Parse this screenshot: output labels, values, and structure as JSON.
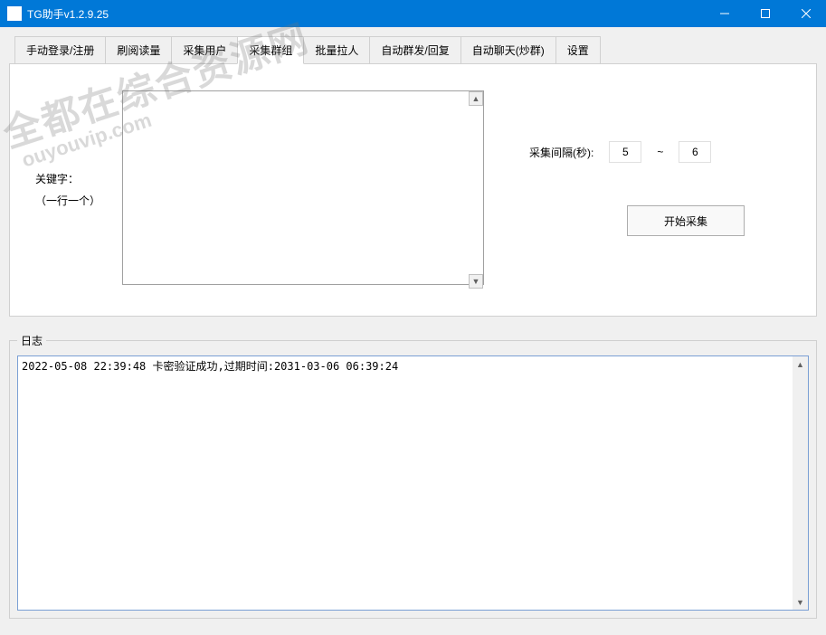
{
  "window": {
    "title": "TG助手v1.2.9.25"
  },
  "tabs": [
    "手动登录/注册",
    "刷阅读量",
    "采集用户",
    "采集群组",
    "批量拉人",
    "自动群发/回复",
    "自动聊天(炒群)",
    "设置"
  ],
  "activeTab": 3,
  "panel": {
    "keywordLabel1": "关键字：",
    "keywordLabel2": "（一行一个）",
    "keywordValue": "",
    "intervalLabel": "采集间隔(秒):",
    "intervalMin": "5",
    "intervalSep": "~",
    "intervalMax": "6",
    "startBtn": "开始采集"
  },
  "log": {
    "legend": "日志",
    "content": "2022-05-08 22:39:48 卡密验证成功,过期时间:2031-03-06 06:39:24"
  },
  "watermark": {
    "line1": "全都在综合资源网",
    "line2": "ouyouvip.com"
  }
}
